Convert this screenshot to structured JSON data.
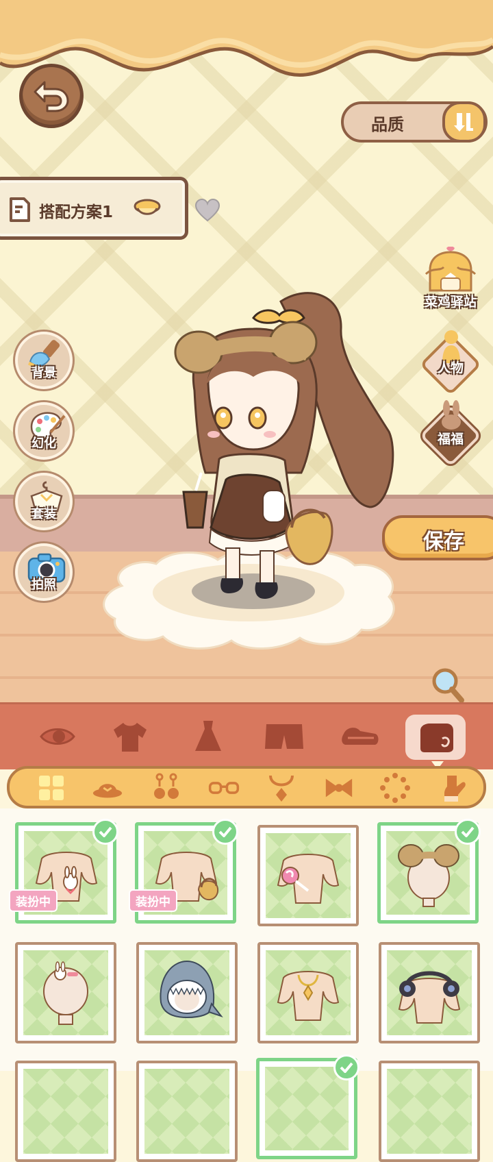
{
  "header": {
    "back_icon": "back-arrow-icon"
  },
  "quality": {
    "label": "品质",
    "sort_icon": "sort-icon"
  },
  "plan": {
    "label": "搭配方案1"
  },
  "left_buttons": [
    {
      "label": "背景",
      "icon": "brush-icon"
    },
    {
      "label": "幻化",
      "icon": "palette-icon"
    },
    {
      "label": "套装",
      "icon": "hanger-icon"
    },
    {
      "label": "拍照",
      "icon": "camera-icon"
    }
  ],
  "right_buttons": {
    "station": "菜鸡驿站",
    "character": "人物",
    "pet": "福福",
    "save": "保存"
  },
  "categories": [
    "eye-icon",
    "shirt-icon",
    "dress-icon",
    "shorts-icon",
    "shoes-icon",
    "bag-icon"
  ],
  "subcategories": [
    "grid-icon",
    "hat-icon",
    "earring-icon",
    "glasses-icon",
    "necklace-icon",
    "bow-icon",
    "bracelet-icon",
    "glove-icon"
  ],
  "items": [
    {
      "name": "bunny-bag",
      "selected": true,
      "badge": "装扮中"
    },
    {
      "name": "basket",
      "selected": true,
      "badge": "装扮中"
    },
    {
      "name": "lollipop",
      "selected": false
    },
    {
      "name": "bear-ear-hair",
      "selected": true
    },
    {
      "name": "bunny-hairclip",
      "selected": false
    },
    {
      "name": "shark-hood",
      "selected": false
    },
    {
      "name": "gold-necklace",
      "selected": false
    },
    {
      "name": "headphones",
      "selected": false
    }
  ],
  "colors": {
    "accent": "#f7c46a",
    "brown": "#7b5440",
    "category_bar": "#d8785e",
    "selected_green": "#7ed487",
    "badge_pink": "#f3a5c0"
  }
}
